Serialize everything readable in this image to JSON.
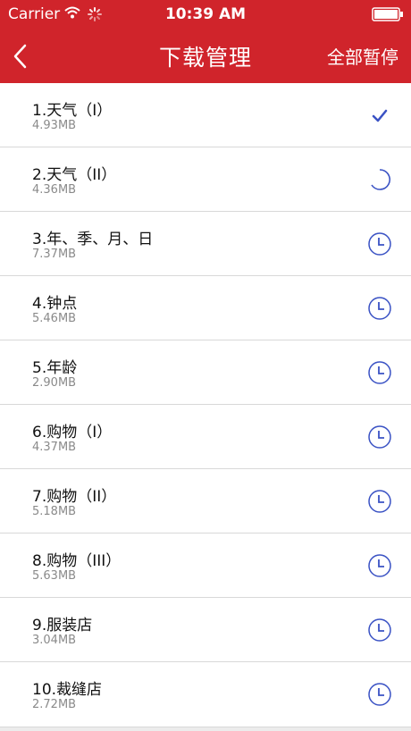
{
  "status_bar": {
    "carrier": "Carrier",
    "time": "10:39 AM"
  },
  "nav": {
    "title": "下载管理",
    "pause_all": "全部暂停"
  },
  "colors": {
    "accent": "#d0242b",
    "icon_blue": "#3a52c4"
  },
  "items": [
    {
      "name": "1.天气（I）",
      "size": "4.93MB",
      "state": "check-icon"
    },
    {
      "name": "2.天气（II）",
      "size": "4.36MB",
      "state": "loading-icon"
    },
    {
      "name": "3.年、季、月、日",
      "size": "7.37MB",
      "state": "clock-icon"
    },
    {
      "name": "4.钟点",
      "size": "5.46MB",
      "state": "clock-icon"
    },
    {
      "name": "5.年龄",
      "size": "2.90MB",
      "state": "clock-icon"
    },
    {
      "name": "6.购物（I）",
      "size": "4.37MB",
      "state": "clock-icon"
    },
    {
      "name": "7.购物（II）",
      "size": "5.18MB",
      "state": "clock-icon"
    },
    {
      "name": "8.购物（III）",
      "size": "5.63MB",
      "state": "clock-icon"
    },
    {
      "name": "9.服装店",
      "size": "3.04MB",
      "state": "clock-icon"
    },
    {
      "name": "10.裁缝店",
      "size": "2.72MB",
      "state": "clock-icon"
    }
  ]
}
